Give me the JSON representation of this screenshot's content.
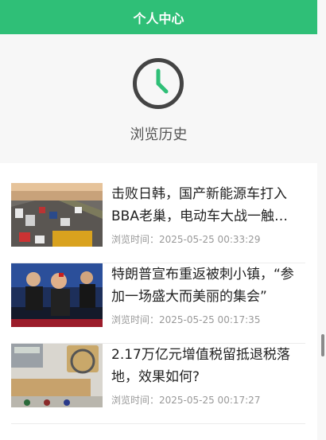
{
  "header": {
    "title": "个人中心"
  },
  "hero": {
    "icon": "clock-icon",
    "label": "浏览历史",
    "accent": "#2fbf77",
    "icon_color": "#444444"
  },
  "history": [
    {
      "title": "击败日韩，国产新能源车打入BBA老巢，电动车大战一触…",
      "time": "浏览时间：2025-05-25 00:33:29",
      "thumb": "highway-traffic"
    },
    {
      "title": "特朗普宣布重返被刺小镇，“参加一场盛大而美丽的集会”",
      "time": "浏览时间：2025-05-25 00:17:35",
      "thumb": "rally-crowd"
    },
    {
      "title": "2.17万亿元增值税留抵退税落地，效果如何?",
      "time": "浏览时间：2025-05-25 00:17:27",
      "thumb": "tax-refund"
    }
  ],
  "colors": {
    "header_bg": "#2fbf77",
    "page_bg": "#f7f7f7"
  }
}
